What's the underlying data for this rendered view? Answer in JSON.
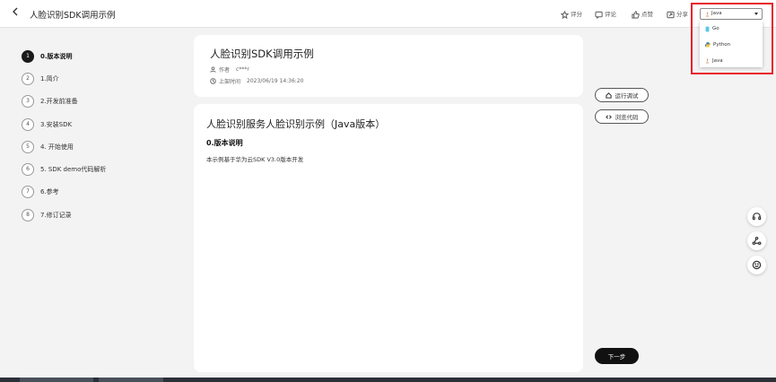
{
  "header": {
    "back_icon": "chevron-left-icon",
    "title": "人脸识别SDK调用示例",
    "actions": [
      {
        "label": "评分",
        "icon": "star-icon"
      },
      {
        "label": "评论",
        "icon": "comment-icon"
      },
      {
        "label": "点赞",
        "icon": "thumb-up-icon"
      },
      {
        "label": "分享",
        "icon": "share-icon"
      }
    ],
    "language_select": {
      "value": "Java",
      "options": [
        "Go",
        "Python",
        "Java"
      ]
    }
  },
  "highlight_color": "#e8202a",
  "steps": [
    {
      "num": "1",
      "label": "0.版本说明",
      "active": true
    },
    {
      "num": "2",
      "label": "1.简介"
    },
    {
      "num": "3",
      "label": "2.开发前准备"
    },
    {
      "num": "4",
      "label": "3.安装SDK"
    },
    {
      "num": "5",
      "label": "4. 开始使用"
    },
    {
      "num": "6",
      "label": "5. SDK demo代码解析"
    },
    {
      "num": "7",
      "label": "6.参考"
    },
    {
      "num": "8",
      "label": "7.修订记录"
    }
  ],
  "article_header": {
    "title": "人脸识别SDK调用示例",
    "author_label": "作者",
    "author": "c***r",
    "time_label": "上架时间",
    "time": "2023/06/19 14:36:20"
  },
  "article_body": {
    "title": "人脸识别服务人脸识别示例（Java版本）",
    "section_title": "0.版本说明",
    "section_text": "本示例基于华为云SDK V3.0版本开发"
  },
  "side_actions": {
    "run_debug": "运行调试",
    "browse_code": "浏览代码",
    "next": "下一步"
  },
  "float_icons": [
    "headset-icon",
    "share-nodes-icon",
    "smile-icon"
  ]
}
